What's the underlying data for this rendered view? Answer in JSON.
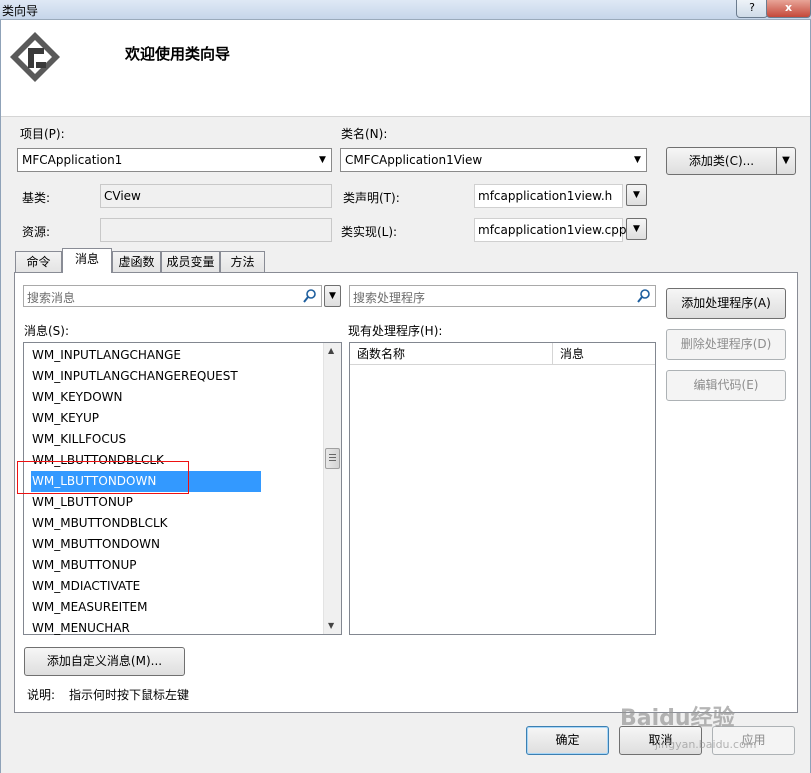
{
  "window": {
    "title": "类向导",
    "help_label": "?",
    "close_label": "x"
  },
  "header": {
    "welcome": "欢迎使用类向导"
  },
  "project": {
    "label": "项目(P):",
    "value": "MFCApplication1"
  },
  "class_name": {
    "label": "类名(N):",
    "value": "CMFCApplication1View"
  },
  "add_class": {
    "label": "添加类(C)..."
  },
  "base_class": {
    "label": "基类:",
    "value": "CView"
  },
  "resource": {
    "label": "资源:",
    "value": ""
  },
  "class_decl": {
    "label": "类声明(T):",
    "value": "mfcapplication1view.h"
  },
  "class_impl": {
    "label": "类实现(L):",
    "value": "mfcapplication1view.cpp"
  },
  "tabs": [
    "命令",
    "消息",
    "虚函数",
    "成员变量",
    "方法"
  ],
  "active_tab": "消息",
  "search_messages": {
    "placeholder": "搜索消息"
  },
  "search_handlers": {
    "placeholder": "搜索处理程序"
  },
  "messages_label": "消息(S):",
  "handlers_label": "现有处理程序(H):",
  "messages": [
    "WM_INPUTLANGCHANGE",
    "WM_INPUTLANGCHANGEREQUEST",
    "WM_KEYDOWN",
    "WM_KEYUP",
    "WM_KILLFOCUS",
    "WM_LBUTTONDBLCLK",
    "WM_LBUTTONDOWN",
    "WM_LBUTTONUP",
    "WM_MBUTTONDBLCLK",
    "WM_MBUTTONDOWN",
    "WM_MBUTTONUP",
    "WM_MDIACTIVATE",
    "WM_MEASUREITEM",
    "WM_MENUCHAR"
  ],
  "selected_message": "WM_LBUTTONDOWN",
  "handler_columns": [
    "函数名称",
    "消息"
  ],
  "buttons": {
    "add_handler": "添加处理程序(A)",
    "delete_handler": "删除处理程序(D)",
    "edit_code": "编辑代码(E)",
    "add_custom_message": "添加自定义消息(M)...",
    "ok": "确定",
    "cancel": "取消",
    "apply": "应用"
  },
  "description": {
    "label": "说明:",
    "text": "指示何时按下鼠标左键"
  },
  "watermark": {
    "logo": "Baidu经验",
    "url": "jingyan.baidu.com"
  },
  "colors": {
    "selection": "#3399ff",
    "highlight_box": "#ee1111"
  }
}
